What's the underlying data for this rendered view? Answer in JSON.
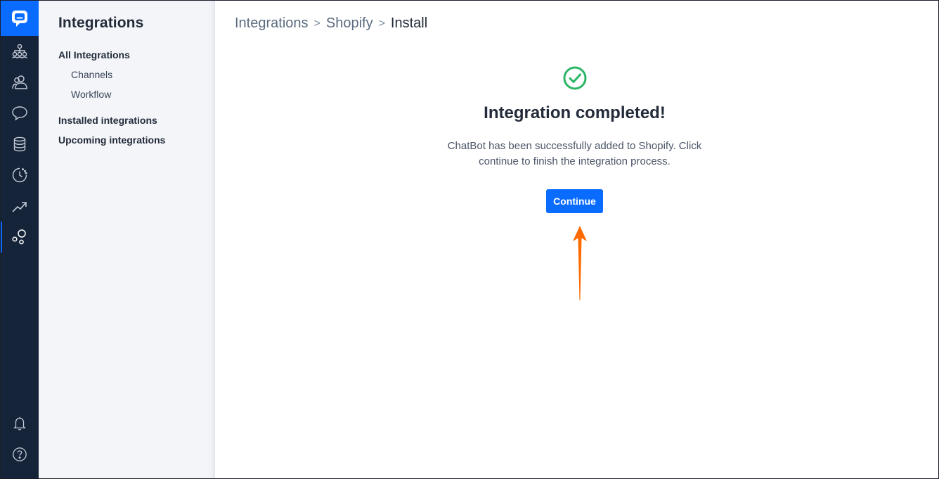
{
  "rail": {
    "logo_icon": "chatbot-logo-icon",
    "items": [
      {
        "icon": "org-chart-icon",
        "active": false
      },
      {
        "icon": "users-icon",
        "active": false
      },
      {
        "icon": "chat-bubble-icon",
        "active": false
      },
      {
        "icon": "database-icon",
        "active": false
      },
      {
        "icon": "history-icon",
        "active": false
      },
      {
        "icon": "trend-up-icon",
        "active": false
      },
      {
        "icon": "integrations-icon",
        "active": true
      }
    ],
    "bottom_items": [
      {
        "icon": "bell-icon"
      },
      {
        "icon": "help-icon"
      }
    ],
    "colors": {
      "background": "#16243a",
      "logo_bg": "#0a6cff",
      "active_indicator": "#0a6cff"
    }
  },
  "sidebar": {
    "title": "Integrations",
    "all_integrations": "All Integrations",
    "channels": "Channels",
    "workflow": "Workflow",
    "installed": "Installed integrations",
    "upcoming": "Upcoming integrations"
  },
  "breadcrumb": {
    "item1": "Integrations",
    "sep1": ">",
    "item2": "Shopify",
    "sep2": ">",
    "current": "Install"
  },
  "main": {
    "status_icon": "check-circle-icon",
    "heading": "Integration completed!",
    "description": "ChatBot has been successfully added to Shopify. Click continue to finish the integration process.",
    "continue_label": "Continue",
    "annotation_icon": "orange-arrow-icon",
    "colors": {
      "success": "#2db566",
      "primary": "#0a6cff",
      "annotation": "#ff6a00"
    }
  }
}
